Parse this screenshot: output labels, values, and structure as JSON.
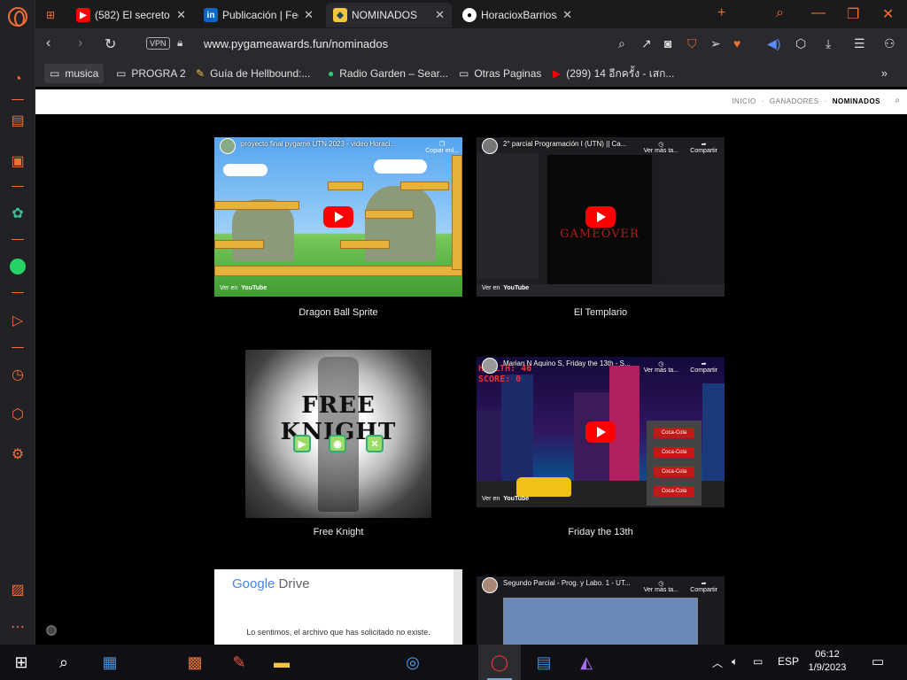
{
  "browser": {
    "tabs": [
      {
        "title": "(582) El secreto e",
        "favicon": "youtube-icon",
        "active": false
      },
      {
        "title": "Publicación | Fee",
        "favicon": "linkedin-icon",
        "active": false
      },
      {
        "title": "NOMINADOS",
        "favicon": "pygame-icon",
        "active": true
      },
      {
        "title": "HoracioxBarrios/",
        "favicon": "github-icon",
        "active": false
      }
    ],
    "new_tab_label": "+",
    "vpn_label": "VPN",
    "url": "www.pygameawards.fun/nominados"
  },
  "bookmarks": [
    {
      "label": "musica",
      "icon": "folder-icon"
    },
    {
      "label": "PROGRA 2",
      "icon": "folder-icon"
    },
    {
      "label": "Guía de Hellbound:...",
      "icon": "note-icon"
    },
    {
      "label": "Radio Garden – Sear...",
      "icon": "radio-icon"
    },
    {
      "label": "Otras Paginas",
      "icon": "folder-icon"
    },
    {
      "label": "(299) 14 อีกครั้ง - เสก...",
      "icon": "youtube-icon"
    }
  ],
  "site": {
    "nav": [
      "INICIO",
      "GANADORES",
      "NOMINADOS"
    ],
    "active_nav": "NOMINADOS",
    "sep": "·"
  },
  "nominees": [
    {
      "caption": "Dragon Ball Sprite",
      "video_title": "proyecto final pygame UTN 2023 - video Horaci...",
      "action": "Copiar enl...",
      "watch_on": "Ver en",
      "yt": "YouTube"
    },
    {
      "caption": "El Templario",
      "video_title": "2° parcial Programación I (UTN) || Ca...",
      "action1": "Ver más ta...",
      "action2": "Compartir",
      "watch_on": "Ver en",
      "yt": "YouTube",
      "game_title": "GAMEOVER"
    },
    {
      "caption": "Free Knight",
      "game_title": "FREE KNIGHT"
    },
    {
      "caption": "Friday the 13th",
      "video_title": "Marian N Aquino S, Friday the 13th - S...",
      "action1": "Ver más ta...",
      "action2": "Compartir",
      "watch_on": "Ver en",
      "yt": "YouTube",
      "hud1": "HEALTH: 46",
      "hud2": "SCORE: 0",
      "can_label": "Coca-Cola"
    }
  ],
  "drive": {
    "logo_google": "Google",
    "logo_drive": "Drive",
    "message": "Lo sentimos, el archivo que has solicitado no existe."
  },
  "segundo": {
    "video_title": "Segundo Parcial - Prog. y Labo. 1 - UT...",
    "action1": "Ver más ta...",
    "action2": "Compartir"
  },
  "taskbar": {
    "language": "ESP",
    "time": "06:12",
    "date": "1/9/2023"
  },
  "colors": {
    "opera_accent": "#f07033",
    "youtube_red": "#ff0000"
  }
}
